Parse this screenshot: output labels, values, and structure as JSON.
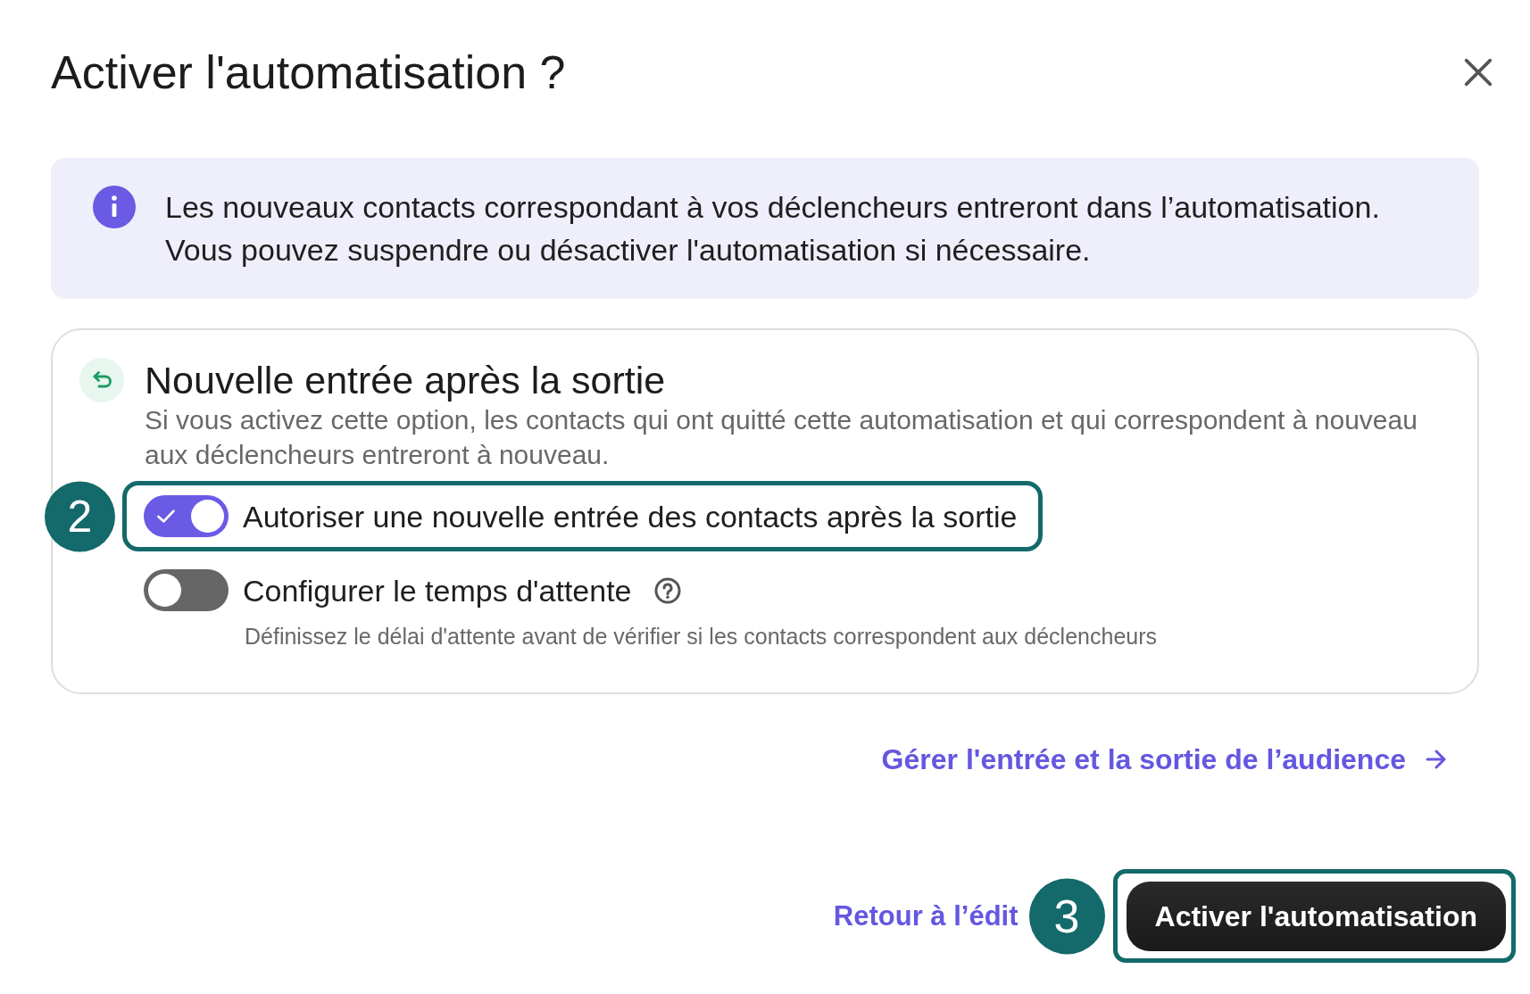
{
  "dialog": {
    "title": "Activer l'automatisation ?"
  },
  "info_banner": {
    "lines": [
      "Les nouveaux contacts correspondant à vos déclencheurs entreront dans l’automatisation.",
      "Vous pouvez suspendre ou désactiver l'automatisation si nécessaire."
    ]
  },
  "reentry_card": {
    "title": "Nouvelle entrée après la sortie",
    "description": "Si vous activez cette option, les contacts qui ont quitté cette automatisation et qui correspondent à nouveau aux déclencheurs entreront à nouveau.",
    "options": [
      {
        "label": "Autoriser une nouvelle entrée des contacts après la sortie",
        "on": true,
        "help": false,
        "step_callout": "2"
      },
      {
        "label": "Configurer le temps d'attente",
        "on": false,
        "help": true,
        "hint": "Définissez le délai d'attente avant de vérifier si les contacts correspondent aux déclencheurs"
      }
    ]
  },
  "audience_link": {
    "label": "Gérer l'entrée et la sortie de l’audience"
  },
  "footer": {
    "back_link": "Retour à l’édit",
    "primary_button": {
      "label": "Activer l'automatisation",
      "step_callout": "3"
    }
  }
}
